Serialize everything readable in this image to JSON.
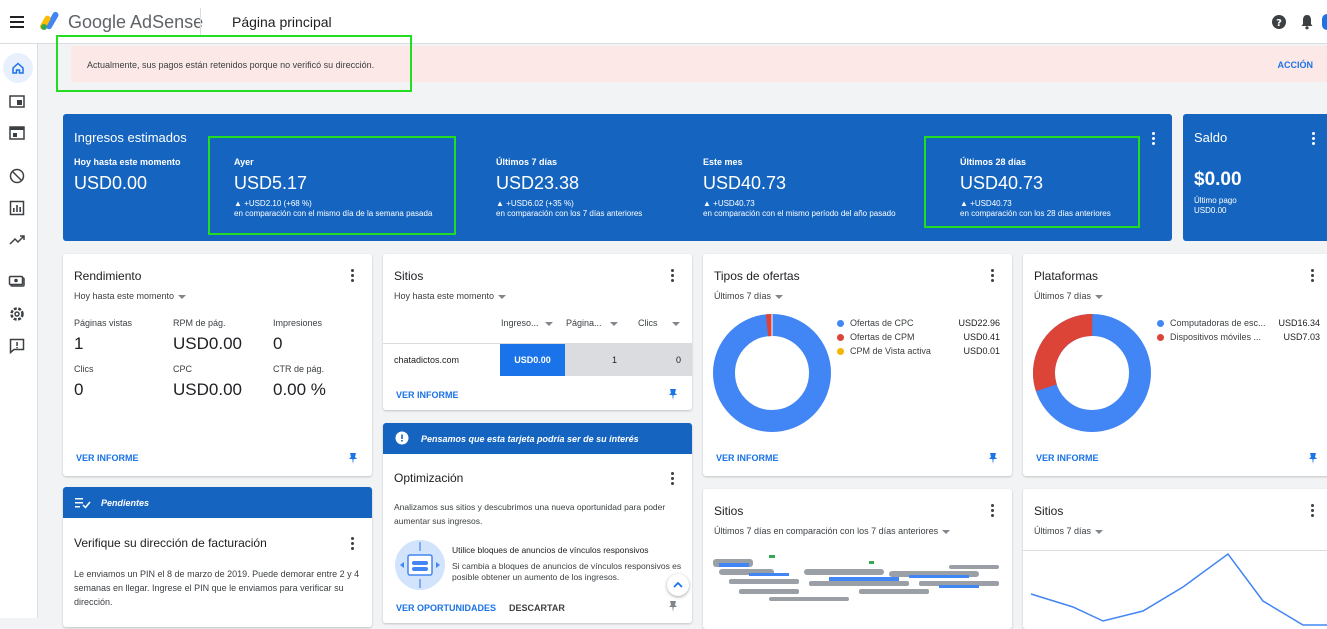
{
  "app": {
    "brand": "Google AdSense",
    "page_title": "Página principal"
  },
  "alert": {
    "text": "Actualmente, sus pagos están retenidos porque no verificó su dirección.",
    "action": "ACCIÓN"
  },
  "earnings": {
    "title": "Ingresos estimados",
    "stats": [
      {
        "label": "Hoy hasta este momento",
        "value": "USD0.00",
        "delta": "",
        "compare": ""
      },
      {
        "label": "Ayer",
        "value": "USD5.17",
        "delta": "▲ +USD2.10 (+68 %)",
        "compare": "en comparación con el mismo día de la semana pasada"
      },
      {
        "label": "Últimos 7 días",
        "value": "USD23.38",
        "delta": "▲ +USD6.02 (+35 %)",
        "compare": "en comparación con los 7 días anteriores"
      },
      {
        "label": "Este mes",
        "value": "USD40.73",
        "delta": "▲ +USD40.73",
        "compare": "en comparación con el mismo período del año pasado"
      },
      {
        "label": "Últimos 28 días",
        "value": "USD40.73",
        "delta": "▲ +USD40.73",
        "compare": "en comparación con los 28 días anteriores"
      }
    ]
  },
  "saldo": {
    "title": "Saldo",
    "value": "$0.00",
    "last_label": "Último pago",
    "last_value": "USD0.00"
  },
  "rendimiento": {
    "title": "Rendimiento",
    "filter": "Hoy hasta este momento",
    "metrics": [
      {
        "label": "Páginas vistas",
        "value": "1"
      },
      {
        "label": "RPM de pág.",
        "value": "USD0.00"
      },
      {
        "label": "Impresiones",
        "value": "0"
      },
      {
        "label": "Clics",
        "value": "0"
      },
      {
        "label": "CPC",
        "value": "USD0.00"
      },
      {
        "label": "CTR de pág.",
        "value": "0.00 %"
      }
    ],
    "link": "VER INFORME"
  },
  "pendientes": {
    "header": "Pendientes",
    "title": "Verifique su dirección de facturación",
    "body": "Le enviamos un PIN el 8 de marzo de 2019. Puede demorar entre 2 y 4 semanas en llegar. Ingrese el PIN que le enviamos para verificar su dirección."
  },
  "sitios": {
    "title": "Sitios",
    "filter": "Hoy hasta este momento",
    "columns": [
      "Ingreso...",
      "Página...",
      "Clics"
    ],
    "rows": [
      {
        "site": "chatadictos.com",
        "ingreso": "USD0.00",
        "paginas": "1",
        "clics": "0"
      }
    ],
    "link": "VER INFORME"
  },
  "sugerencia": {
    "header": "Pensamos que esta tarjeta podría ser de su interés",
    "title": "Optimización",
    "intro": "Analizamos sus sitios y descubrimos una nueva oportunidad para poder aumentar sus ingresos.",
    "item_title": "Utilice bloques de anuncios de vínculos responsivos",
    "item_body": "Si cambia a bloques de anuncios de vínculos responsivos es posible obtener un aumento de los ingresos.",
    "link": "VER OPORTUNIDADES",
    "dismiss": "DESCARTAR"
  },
  "tipos": {
    "title": "Tipos de ofertas",
    "filter": "Últimos 7 días",
    "items": [
      {
        "label": "Ofertas de CPC",
        "value": "USD22.96",
        "color": "#4285f4"
      },
      {
        "label": "Ofertas de CPM",
        "value": "USD0.41",
        "color": "#db4437"
      },
      {
        "label": "CPM de Vista activa",
        "value": "USD0.01",
        "color": "#f4b400"
      }
    ],
    "link": "VER INFORME"
  },
  "plataformas": {
    "title": "Plataformas",
    "filter": "Últimos 7 días",
    "items": [
      {
        "label": "Computadoras de esc...",
        "value": "USD16.34",
        "color": "#4285f4"
      },
      {
        "label": "Dispositivos móviles ...",
        "value": "USD7.03",
        "color": "#db4437"
      }
    ],
    "link": "VER INFORME"
  },
  "sitios2": {
    "title": "Sitios",
    "filter": "Últimos 7 días en comparación con los 7 días anteriores"
  },
  "sitios3": {
    "title": "Sitios",
    "filter": "Últimos 7 días"
  },
  "colors": {
    "accent": "#1565c0",
    "link": "#1a73e8",
    "alert_bg": "#fce8e6"
  }
}
